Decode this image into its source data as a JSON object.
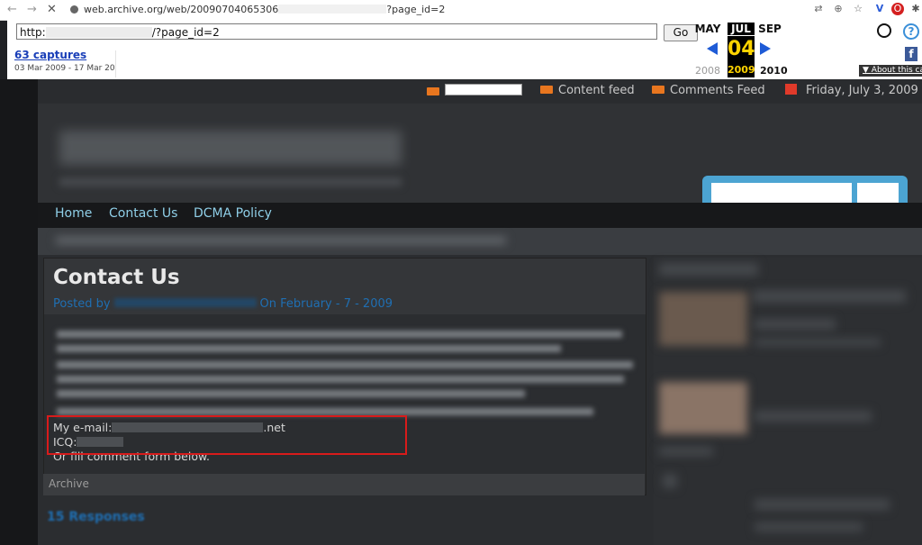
{
  "browser": {
    "url_prefix": "web.archive.org/web/20090704065306",
    "url_suffix": "?page_id=2"
  },
  "wayback": {
    "input_prefix": "http:",
    "input_suffix": "/?page_id=2",
    "go_label": "Go",
    "captures": "63 captures",
    "date_range": "03 Mar 2009 - 17 Mar 2021",
    "months": {
      "prev": "MAY",
      "current": "JUL",
      "next": "SEP"
    },
    "day": "04",
    "years": {
      "prev": "2008",
      "current": "2009",
      "next": "2010"
    },
    "about": "About this ca"
  },
  "site": {
    "feeds": {
      "content": "Content feed",
      "comments": "Comments Feed",
      "date": "Friday, July 3, 2009"
    },
    "nav": [
      "Home",
      "Contact Us",
      "DCMA Policy"
    ],
    "post": {
      "title": "Contact Us",
      "posted_by": "Posted by",
      "posted_on": "On February - 7 - 2009",
      "email_label": "My e-mail:",
      "email_suffix": ".net",
      "icq_label": "ICQ:",
      "fill_text": "Or fill comment form below.",
      "archive": "Archive"
    },
    "responses": "15 Responses"
  },
  "colors": {
    "accent_link": "#8fcfe8",
    "wayback_blue": "#1e5bd6",
    "highlight_red": "#d81b1b"
  }
}
